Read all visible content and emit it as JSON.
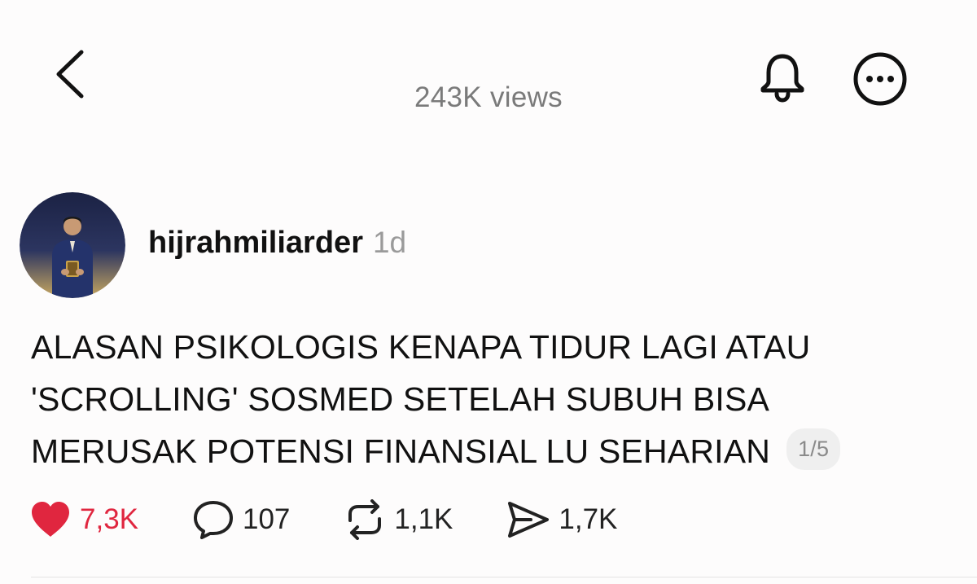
{
  "header": {
    "views_label": "243K views"
  },
  "post": {
    "author": {
      "username": "hijrahmiliarder",
      "timestamp": "1d"
    },
    "text_lines": [
      "ALASAN PSIKOLOGIS KENAPA TIDUR LAGI ATAU",
      "'SCROLLING' SOSMED SETELAH SUBUH BISA",
      "MERUSAK POTENSI FINANSIAL LU SEHARIAN"
    ],
    "page_indicator": "1/5"
  },
  "actions": {
    "likes": "7,3K",
    "replies": "107",
    "reposts": "1,1K",
    "shares": "1,7K"
  },
  "icons": {
    "back": "chevron-left-icon",
    "notifications": "bell-icon",
    "more": "more-horizontal-icon",
    "like": "heart-filled-icon",
    "reply": "speech-bubble-icon",
    "repost": "repost-icon",
    "share": "send-icon"
  },
  "colors": {
    "like_accent": "#e0263f",
    "text_primary": "#111111",
    "text_secondary": "#9a9a9a",
    "background": "#fdfcfc"
  }
}
